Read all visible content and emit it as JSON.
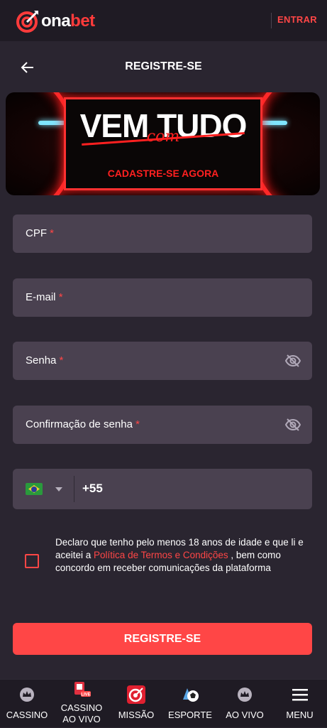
{
  "topbar": {
    "logo_text_a": "ona",
    "logo_text_b": "bet",
    "login_label": "ENTRAR"
  },
  "header": {
    "title": "REGISTRE-SE"
  },
  "banner": {
    "headline": "VEM TUDO",
    "script": "com",
    "subline": "CADASTRE-SE AGORA"
  },
  "form": {
    "cpf_label": "CPF",
    "email_label": "E-mail",
    "password_label": "Senha",
    "confirm_label": "Confirmação de senha",
    "required_mark": "*",
    "phone_code": "+55"
  },
  "terms": {
    "text_before": "Declaro que tenho pelo menos 18 anos de idade e que li e aceitei a ",
    "link": "Política de Termos e Condições",
    "text_after": " , bem como concordo em receber comunicações da plataforma"
  },
  "submit_label": "REGISTRE-SE",
  "bottom_nav": [
    {
      "label": "CASSINO",
      "icon": "crown-icon"
    },
    {
      "label": "CASSINO\nAO VIVO",
      "icon": "live-casino-icon",
      "badge": "LIVE"
    },
    {
      "label": "MISSÃO",
      "icon": "target-icon"
    },
    {
      "label": "ESPORTE",
      "icon": "soccer-icon"
    },
    {
      "label": "AO VIVO",
      "icon": "crown-icon"
    },
    {
      "label": "MENU",
      "icon": "hamburger-icon"
    }
  ],
  "colors": {
    "accent": "#ff4646",
    "background": "#2a2530",
    "field": "#4a4150",
    "nav": "#1f1b24"
  }
}
